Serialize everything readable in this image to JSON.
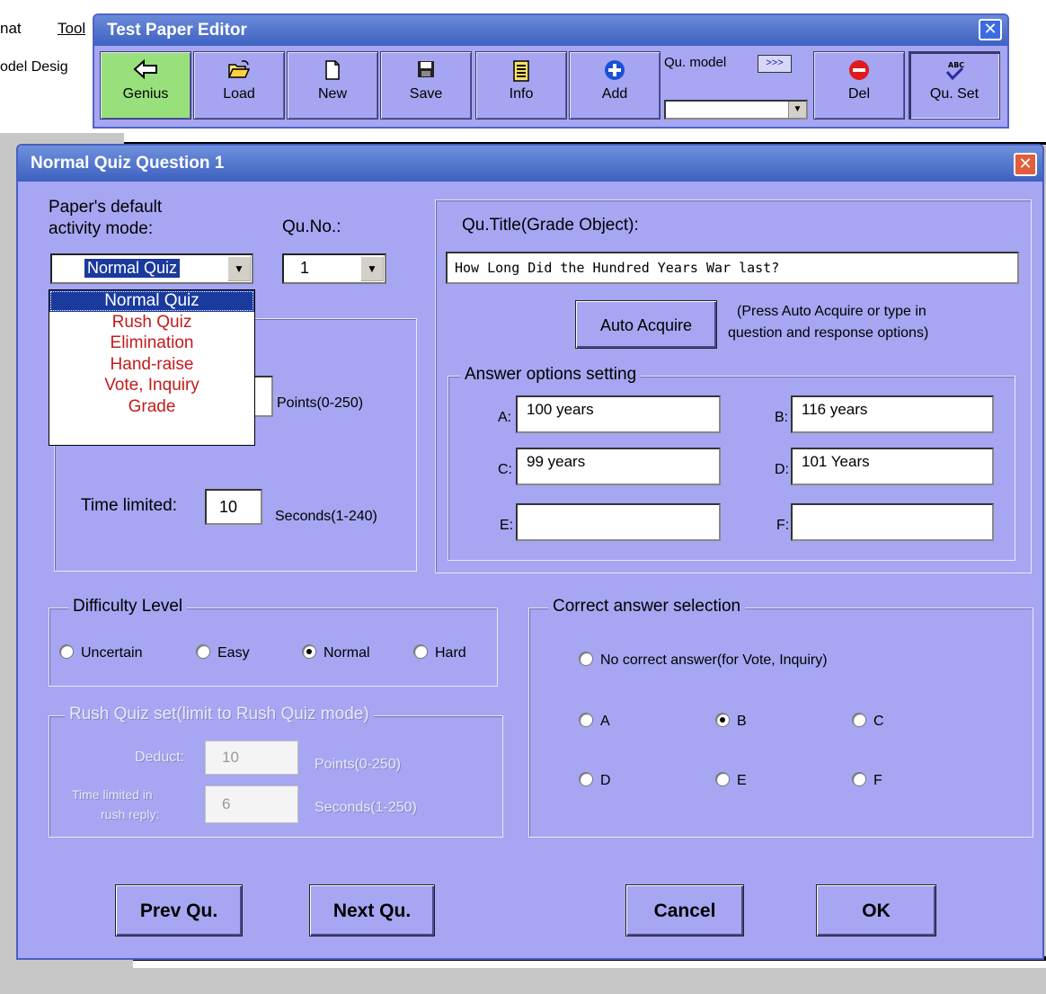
{
  "host_app": {
    "menu": [
      "nat",
      "Tool"
    ],
    "toolbar_text": "odel Desig"
  },
  "editor": {
    "title": "Test Paper Editor",
    "close_glyph": "✕",
    "buttons": [
      {
        "label": "Genius",
        "icon": "back-arrow-icon"
      },
      {
        "label": "Load",
        "icon": "open-folder-icon"
      },
      {
        "label": "New",
        "icon": "new-document-icon"
      },
      {
        "label": "Save",
        "icon": "floppy-disk-icon"
      },
      {
        "label": "Info",
        "icon": "info-sheet-icon"
      },
      {
        "label": "Add",
        "icon": "plus-circle-icon"
      },
      {
        "label": "Del",
        "icon": "minus-circle-icon"
      },
      {
        "label": "Qu. Set",
        "icon": "spell-check-icon"
      }
    ],
    "qu_model_label": "Qu. model",
    "qu_model_more": ">>>",
    "qu_model_value": ""
  },
  "dialog": {
    "title": "Normal Quiz Question 1",
    "close_glyph": "✕",
    "mode_label_1": "Paper's default",
    "mode_label_2": "activity mode:",
    "mode_value": "Normal Quiz",
    "mode_options": [
      "Normal Quiz",
      "Rush Quiz",
      "Elimination",
      "Hand-raise",
      "Vote, Inquiry",
      "Grade"
    ],
    "quno_label": "Qu.No.:",
    "quno_value": "1",
    "points_label": "Points(0-250)",
    "time_label": "Time limited:",
    "time_value": "10",
    "seconds_label": "Seconds(1-240)",
    "title_label": "Qu.Title(Grade Object):",
    "title_value": "How Long Did the Hundred Years War last?",
    "auto_acquire": "Auto Acquire",
    "auto_hint_1": "(Press Auto Acquire or type in",
    "auto_hint_2": "question and response options)",
    "answers_group": "Answer options setting",
    "answers": [
      {
        "key": "A:",
        "value": "100 years"
      },
      {
        "key": "B:",
        "value": "116 years"
      },
      {
        "key": "C:",
        "value": "99 years"
      },
      {
        "key": "D:",
        "value": "101 Years"
      },
      {
        "key": "E:",
        "value": ""
      },
      {
        "key": "F:",
        "value": ""
      }
    ],
    "difficulty_group": "Difficulty Level",
    "difficulty": [
      {
        "label": "Uncertain",
        "checked": false
      },
      {
        "label": "Easy",
        "checked": false
      },
      {
        "label": "Normal",
        "checked": true
      },
      {
        "label": "Hard",
        "checked": false
      }
    ],
    "rush_group": "Rush Quiz set(limit to Rush Quiz mode)",
    "rush_deduct_label": "Deduct:",
    "rush_deduct_value": "10",
    "rush_points_label": "Points(0-250)",
    "rush_time_label_1": "Time limited in",
    "rush_time_label_2": "rush reply:",
    "rush_time_value": "6",
    "rush_seconds_label": "Seconds(1-250)",
    "correct_group": "Correct answer selection",
    "no_correct": "No correct answer(for Vote, Inquiry)",
    "correct_options": [
      {
        "label": "A",
        "checked": false
      },
      {
        "label": "B",
        "checked": true
      },
      {
        "label": "C",
        "checked": false
      },
      {
        "label": "D",
        "checked": false
      },
      {
        "label": "E",
        "checked": false
      },
      {
        "label": "F",
        "checked": false
      }
    ],
    "prev_btn": "Prev Qu.",
    "next_btn": "Next Qu.",
    "cancel_btn": "Cancel",
    "ok_btn": "OK"
  }
}
